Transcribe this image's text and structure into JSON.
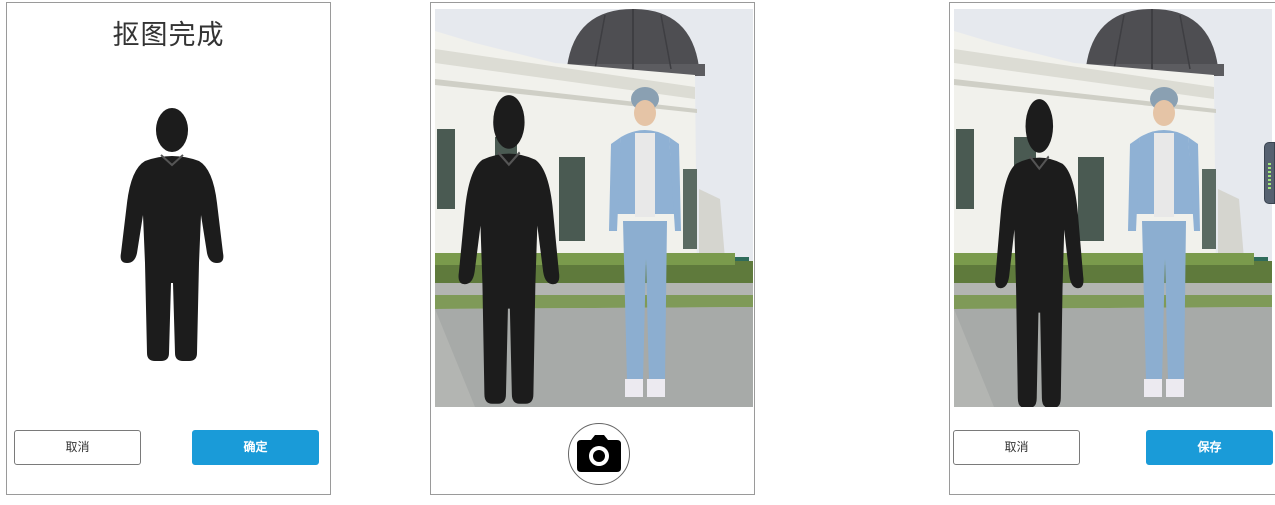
{
  "left_panel": {
    "title": "抠图完成",
    "cancel_label": "取消",
    "confirm_label": "确定"
  },
  "middle_panel": {
    "camera_icon": "camera-icon"
  },
  "right_panel": {
    "cancel_label": "取消",
    "save_label": "保存"
  },
  "colors": {
    "primary": "#1a9bd8",
    "silhouette": "#1c1c1c",
    "border": "#9a9a9a"
  }
}
